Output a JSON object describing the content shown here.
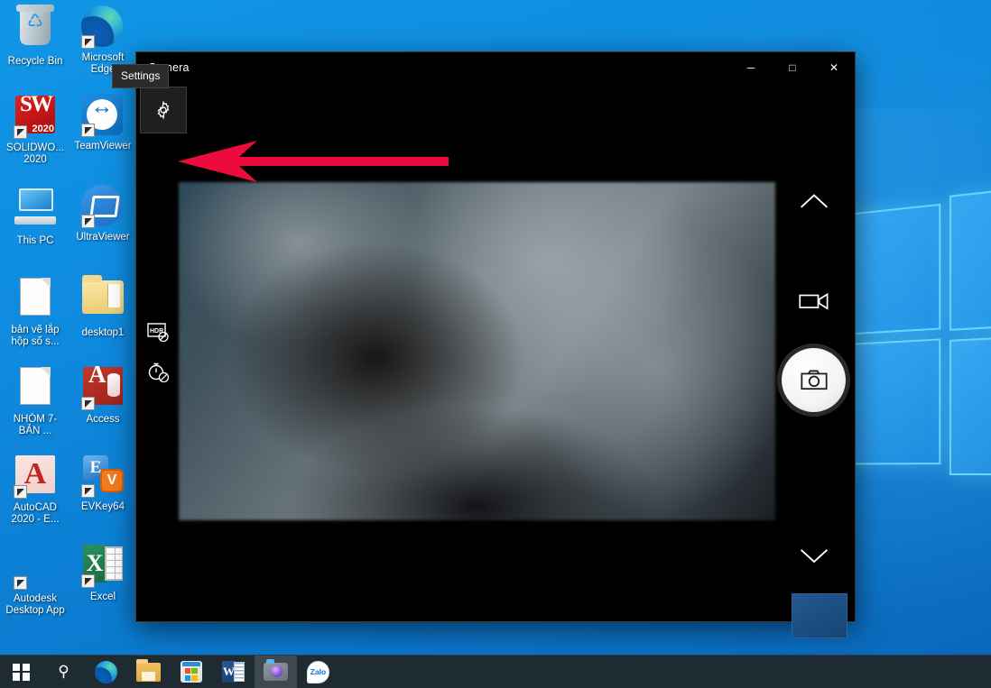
{
  "desktop": {
    "icons": [
      {
        "label": "Recycle Bin",
        "icon": "recycle-bin-icon",
        "shortcut": false
      },
      {
        "label": "Microsoft Edge",
        "icon": "microsoft-edge-icon",
        "shortcut": true
      },
      {
        "label": "SOLIDWO... 2020",
        "icon": "solidworks-2020-icon",
        "shortcut": true,
        "badge": "2020",
        "mark_s": "S",
        "mark_w": "W"
      },
      {
        "label": "TeamViewer",
        "icon": "teamviewer-icon",
        "shortcut": true
      },
      {
        "label": "This PC",
        "icon": "this-pc-icon",
        "shortcut": false
      },
      {
        "label": "UltraViewer",
        "icon": "ultraviewer-icon",
        "shortcut": true
      },
      {
        "label": "bản vẽ lắp hộp số s...",
        "icon": "document-icon",
        "shortcut": false
      },
      {
        "label": "desktop1",
        "icon": "folder-icon",
        "shortcut": false
      },
      {
        "label": "NHÓM 7-BẢN ...",
        "icon": "document-icon",
        "shortcut": false
      },
      {
        "label": "Access",
        "icon": "microsoft-access-icon",
        "shortcut": true,
        "letter": "A"
      },
      {
        "label": "AutoCAD 2020 - E...",
        "icon": "autocad-2020-icon",
        "shortcut": true
      },
      {
        "label": "EVKey64",
        "icon": "evkey64-icon",
        "shortcut": true,
        "letter_e": "E",
        "letter_v": "V"
      },
      {
        "label": "Autodesk Desktop App",
        "icon": "autodesk-desktop-app-icon",
        "shortcut": true
      },
      {
        "label": "Excel",
        "icon": "microsoft-excel-icon",
        "shortcut": true,
        "letter": "X"
      }
    ]
  },
  "camera_window": {
    "title": "Camera",
    "controls": {
      "minimize": "─",
      "maximize": "□",
      "close": "✕"
    },
    "tooltip": {
      "text": "Settings"
    },
    "settings_button_name": "Settings",
    "left_rail": [
      {
        "name": "hdr-off-button",
        "label": "HDR off"
      },
      {
        "name": "photo-timer-off-button",
        "label": "Photo timer off"
      }
    ],
    "right_rail": {
      "chevron_up_label": "Show more",
      "video_mode_label": "Take video",
      "capture_label": "Take photo",
      "chevron_down_label": "Show fewer",
      "gallery_label": "View photos and videos"
    }
  },
  "taskbar": {
    "items": [
      {
        "label": "Start",
        "icon": "windows-start-icon",
        "active": false
      },
      {
        "label": "Search",
        "icon": "search-icon",
        "active": false
      },
      {
        "label": "Microsoft Edge",
        "icon": "microsoft-edge-icon",
        "active": false
      },
      {
        "label": "File Explorer",
        "icon": "file-explorer-icon",
        "active": false
      },
      {
        "label": "Microsoft Store",
        "icon": "microsoft-store-icon",
        "active": false
      },
      {
        "label": "Word",
        "icon": "microsoft-word-icon",
        "active": false
      },
      {
        "label": "Camera",
        "icon": "camera-icon",
        "active": true
      },
      {
        "label": "Zalo",
        "icon": "zalo-icon",
        "active": false,
        "text": "Zalo"
      }
    ]
  },
  "annotation": {
    "arrow_color": "#ec0b3c",
    "arrow_direction": "left",
    "points_to": "settings-button"
  },
  "colors": {
    "desktop_blue": "#0f8ce0",
    "taskbar": "#1f2b33",
    "window_black": "#000000",
    "accent_red": "#ec0b3c"
  }
}
